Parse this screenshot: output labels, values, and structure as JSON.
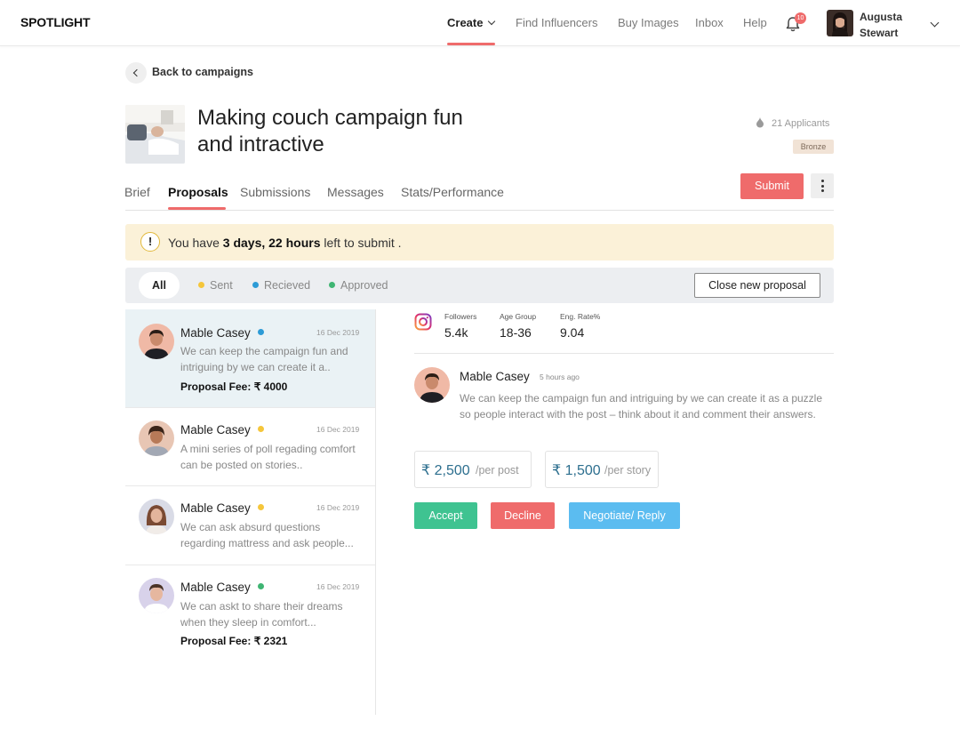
{
  "brand": "SPOTLIGHT",
  "nav": {
    "create": "Create",
    "find": "Find Influencers",
    "buy": "Buy Images",
    "inbox": "Inbox",
    "help": "Help",
    "notif_count": "10",
    "user_first": "Augusta",
    "user_last": "Stewart"
  },
  "back_label": "Back to campaigns",
  "campaign": {
    "title": "Making couch campaign fun and intractive",
    "applicants": "21 Applicants",
    "tier": "Bronze"
  },
  "tabs": [
    "Brief",
    "Proposals",
    "Submissions",
    "Messages",
    "Stats/Performance"
  ],
  "submit_label": "Submit",
  "alert": {
    "prefix": "You have ",
    "bold": "3 days, 22 hours",
    "suffix": " left to submit ."
  },
  "filters": {
    "all": "All",
    "sent": "Sent",
    "received": "Recieved",
    "approved": "Approved",
    "close_button": "Close new proposal"
  },
  "colors": {
    "accent": "#ef6b6b",
    "sent": "#f5c63b",
    "received": "#2d9bd6",
    "approved": "#3fb573",
    "accept": "#3fc391",
    "reply": "#5bbcf0"
  },
  "proposals": [
    {
      "name": "Mable Casey",
      "status": "received",
      "date": "16 Dec 2019",
      "message": "We can keep the campaign fun and intriguing by we can create it a..",
      "fee": "Proposal Fee: ₹ 4000"
    },
    {
      "name": "Mable Casey",
      "status": "sent",
      "date": "16 Dec 2019",
      "message": "A mini series of poll regading comfort can be posted on stories..",
      "fee": ""
    },
    {
      "name": "Mable Casey",
      "status": "sent",
      "date": "16 Dec 2019",
      "message": "We can ask absurd questions regarding mattress and ask people...",
      "fee": ""
    },
    {
      "name": "Mable Casey",
      "status": "approved",
      "date": "16 Dec 2019",
      "message": "We can askt to share their dreams when they sleep in comfort...",
      "fee": "Proposal Fee: ₹ 2321"
    }
  ],
  "stats": {
    "followers_label": "Followers",
    "followers": "5.4k",
    "age_label": "Age Group",
    "age": "18-36",
    "eng_label": "Eng. Rate%",
    "eng": "9.04"
  },
  "detail": {
    "name": "Mable Casey",
    "time": "5 hours ago",
    "message": "We can keep the campaign fun and intriguing by we can create it as a puzzle so people interact with the post – think about it and comment their answers.",
    "post_price": "₹ 2,500",
    "post_unit": "/per post",
    "story_price": "₹ 1,500",
    "story_unit": "/per story",
    "accept": "Accept",
    "decline": "Decline",
    "reply": "Negotiate/ Reply"
  }
}
